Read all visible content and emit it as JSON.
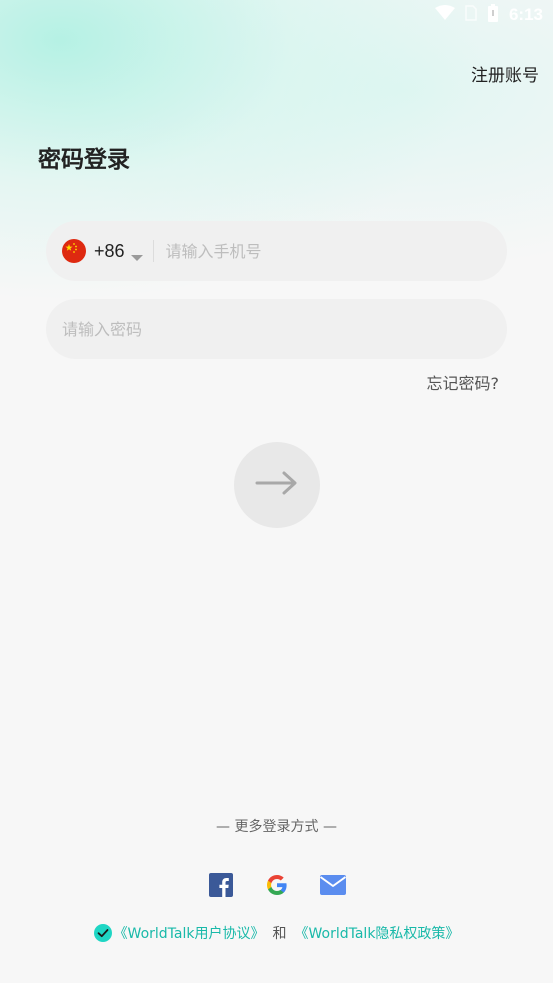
{
  "status_bar": {
    "time": "6:13",
    "icons": [
      "wifi-icon",
      "no-sim-icon",
      "battery-icon"
    ]
  },
  "header": {
    "register_label": "注册账号",
    "title": "密码登录"
  },
  "phone_field": {
    "flag": "china-flag-icon",
    "country_code": "+86",
    "placeholder": "请输入手机号",
    "value": ""
  },
  "password_field": {
    "placeholder": "请输入密码",
    "value": ""
  },
  "forgot_password_label": "忘记密码?",
  "submit": {
    "icon": "arrow-right-icon",
    "enabled": false
  },
  "more_login": {
    "label": "— 更多登录方式 —",
    "providers": [
      "facebook-icon",
      "google-icon",
      "email-icon"
    ]
  },
  "agreement": {
    "checked": true,
    "user_agreement": "《WorldTalk用户协议》",
    "and": "和",
    "privacy_policy": "《WorldTalk隐私权政策》"
  },
  "colors": {
    "accent": "#19b9a9",
    "check": "#1fd6c4",
    "field_bg": "#f0f0f0",
    "button_bg": "#e8e8e8",
    "facebook": "#3b5998",
    "email": "#5b8def"
  }
}
